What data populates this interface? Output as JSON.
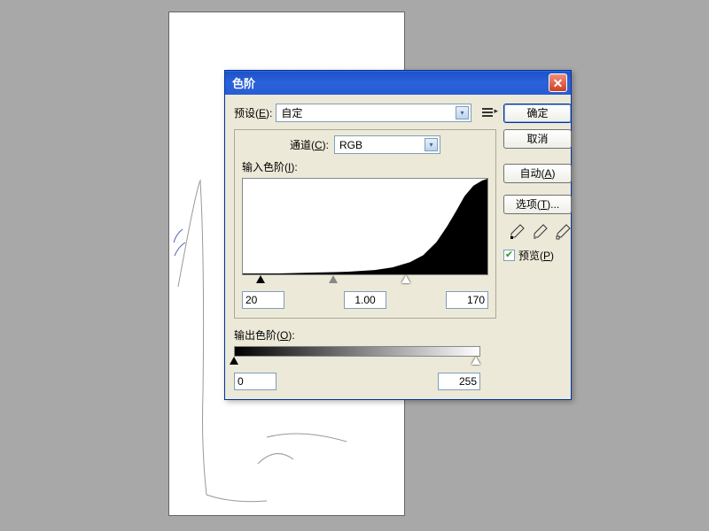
{
  "dialog": {
    "title": "色阶",
    "preset_label_pre": "预设(",
    "preset_label_key": "E",
    "preset_label_post": "):",
    "preset_value": "自定",
    "channel_label_pre": "通道(",
    "channel_label_key": "C",
    "channel_label_post": "):",
    "channel_value": "RGB",
    "input_levels_label_pre": "输入色阶(",
    "input_levels_label_key": "I",
    "input_levels_label_post": "):",
    "input_black": "20",
    "input_mid": "1.00",
    "input_white": "170",
    "output_levels_label_pre": "输出色阶(",
    "output_levels_label_key": "O",
    "output_levels_label_post": "):",
    "output_black": "0",
    "output_white": "255"
  },
  "buttons": {
    "ok": "确定",
    "cancel": "取消",
    "auto_pre": "自动(",
    "auto_key": "A",
    "auto_post": ")",
    "options_pre": "选项(",
    "options_key": "T",
    "options_post": ")..."
  },
  "preview": {
    "label_pre": "预览(",
    "label_key": "P",
    "label_post": ")",
    "checked": true
  }
}
